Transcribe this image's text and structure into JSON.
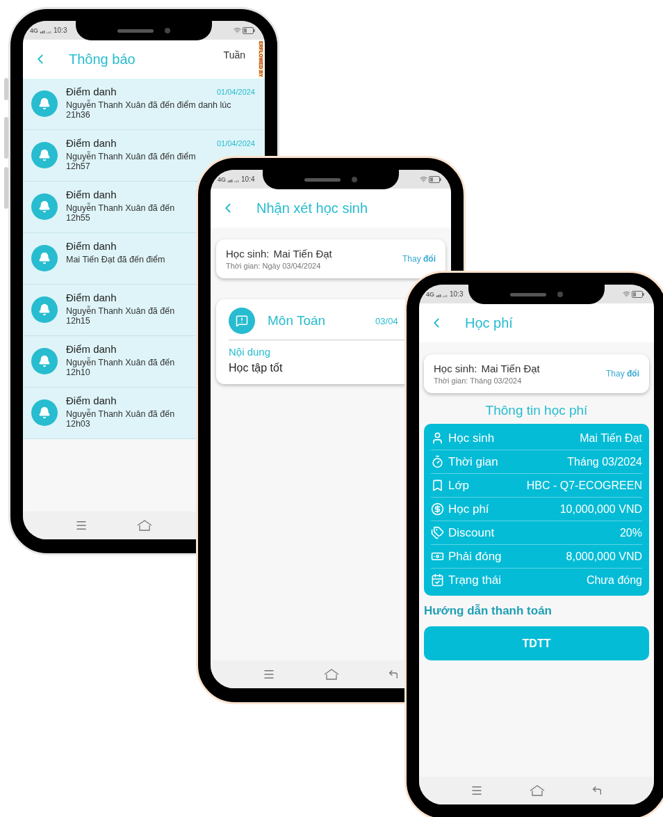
{
  "phones": [
    {
      "kind": "notifications",
      "network": "4G",
      "status_time": "10:3",
      "title": "Thông báo",
      "action": "Tuần",
      "overflow_label": "ERFLOWED BY",
      "notifications": [
        {
          "title": "Điểm danh",
          "date": "01/04/2024",
          "message": "Nguyễn Thanh Xuân đã đến điểm danh lúc",
          "time": "21h36"
        },
        {
          "title": "Điểm danh",
          "date": "01/04/2024",
          "message": "Nguyễn Thanh Xuân đã đến điểm",
          "time": "12h57"
        },
        {
          "title": "Điểm danh",
          "message": "Nguyễn Thanh Xuân đã đến",
          "time": "12h55"
        },
        {
          "title": "Điểm danh",
          "message": "Mai Tiến Đạt đã đến điểm"
        },
        {
          "title": "Điểm danh",
          "message": "Nguyễn Thanh Xuân đã đến",
          "time": "12h15"
        },
        {
          "title": "Điểm danh",
          "message": "Nguyễn Thanh Xuân đã đến",
          "time": "12h10"
        },
        {
          "title": "Điểm danh",
          "message": "Nguyễn Thanh Xuân đã đến",
          "time": "12h03"
        }
      ]
    },
    {
      "kind": "review",
      "network": "4G",
      "status_time": "10:4",
      "title": "Nhận xét học sinh",
      "student_card": {
        "label": "Học sinh:",
        "value": "Mai Tiến Đạt",
        "subtitle": "Thời gian: Ngày 03/04/2024",
        "link": "Thay **đổi**"
      },
      "review": {
        "subject": "Môn Toán",
        "date": "03/04",
        "content_label": "Nội dung",
        "content": "Học tập tốt"
      }
    },
    {
      "kind": "fee",
      "network": "4G",
      "status_time": "10:3",
      "title": "Học phí",
      "student_card": {
        "label": "Học sinh:",
        "value": "Mai Tiến Đạt",
        "subtitle": "Thời gian: Tháng 03/2024",
        "link": "Thay **đổi**"
      },
      "section_title": "Thông tin học phí",
      "rows": [
        {
          "label": "Học sinh",
          "value": "Mai Tiến Đạt"
        },
        {
          "label": "Thời gian",
          "value": "Tháng 03/2024"
        },
        {
          "label": "Lớp",
          "value": "HBC - Q7-ECOGREEN"
        },
        {
          "label": "Học phí",
          "value": "10,000,000 VND"
        },
        {
          "label": "Discount",
          "value": "20%"
        },
        {
          "label": "Phải đóng",
          "value": "8,000,000 VND"
        },
        {
          "label": "Trạng thái",
          "value": "Chưa đóng"
        }
      ],
      "payment_title": "Hướng dẫn thanh toán",
      "payment_button": "TDTT"
    }
  ]
}
